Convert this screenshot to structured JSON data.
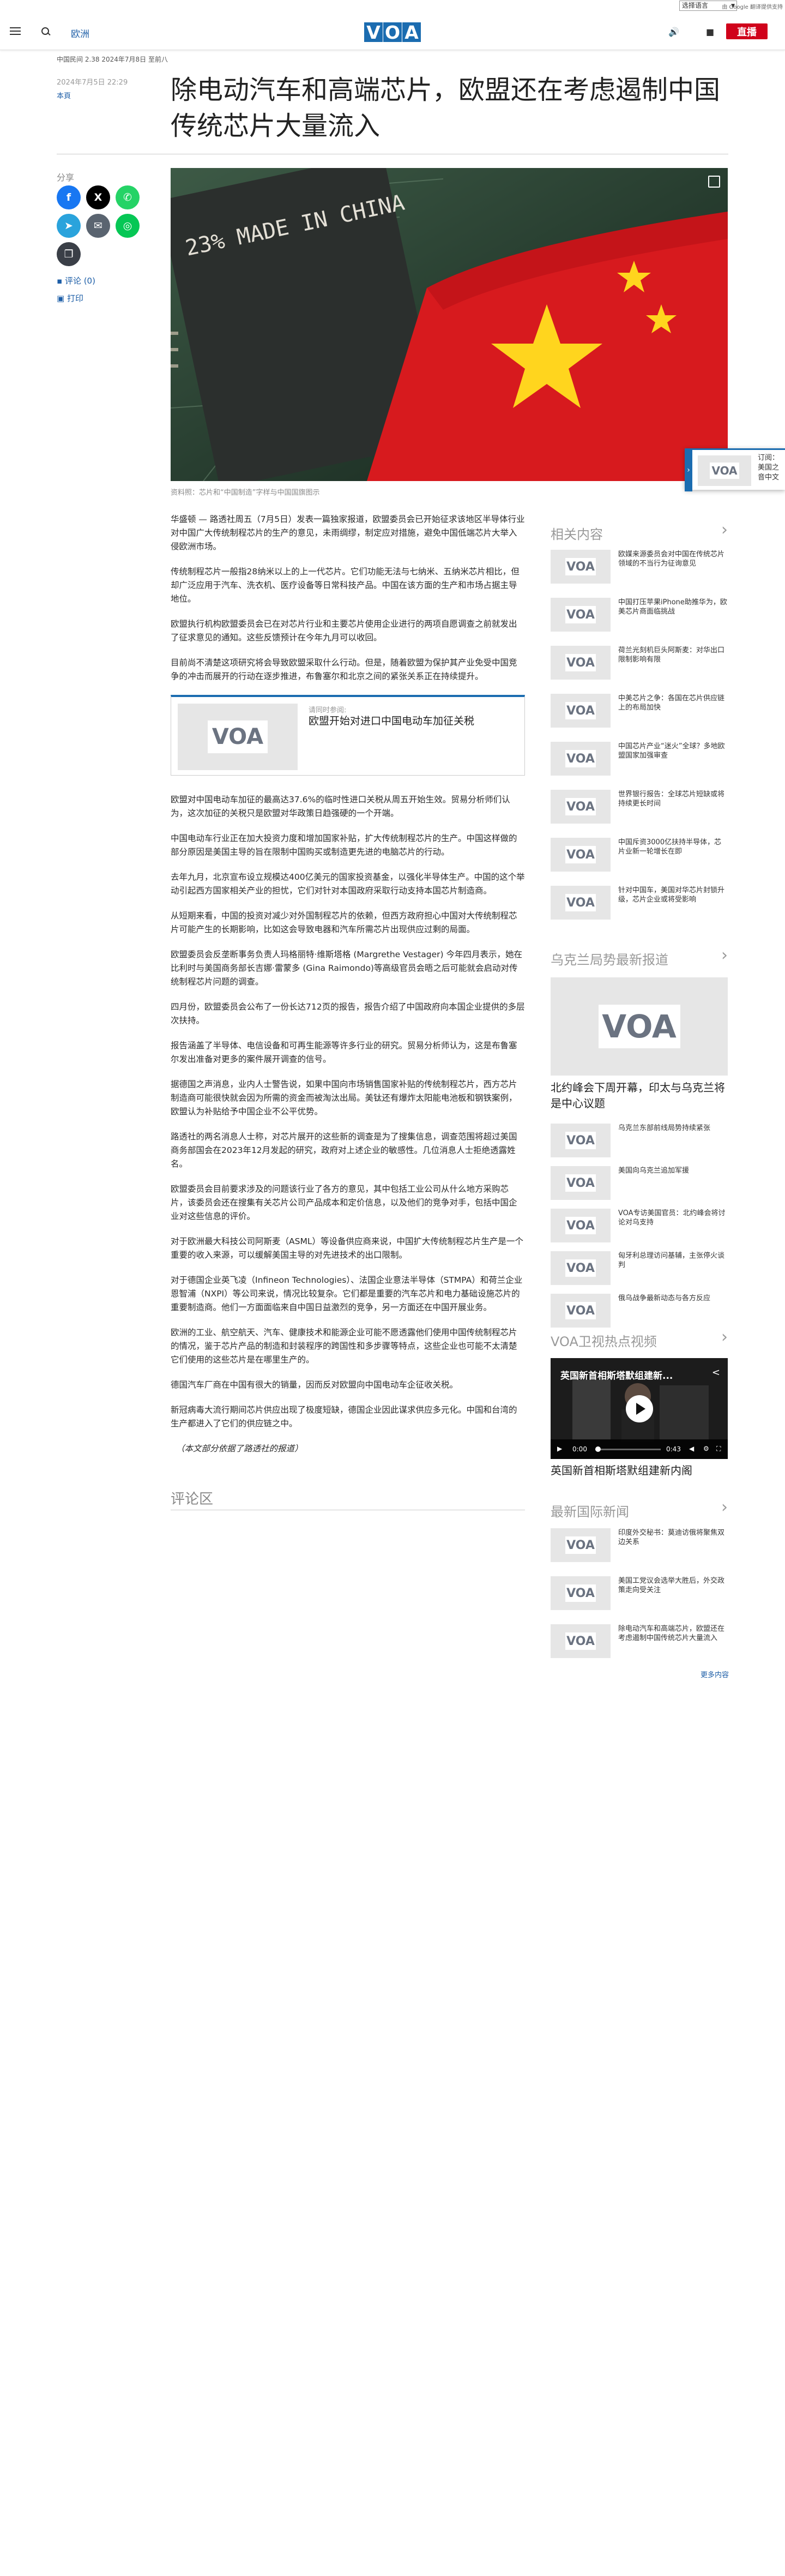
{
  "topbar": {
    "language_select": "选择语言",
    "translate_powered": "由 Google 翻译提供支持"
  },
  "header": {
    "section": "欧洲",
    "logo": [
      "V",
      "O",
      "A"
    ],
    "live_label": "直播"
  },
  "article": {
    "intro": "中国民间 2.38 2024年7月8日 至前八",
    "date": "2024年7月5日 22:29",
    "author": "本頁",
    "title": "除电动汽车和高端芯片，欧盟还在考虑遏制中国传统芯片大量流入",
    "share_label": "分享",
    "comment_link": "评论 (0)",
    "print_link": "打印",
    "image_caption": "资料照：芯片和“中国制造”字样与中国国旗图示",
    "image_text": "23% MADE IN CHINA",
    "paragraphs_a": [
      "华盛顿 — 路透社周五（7月5日）发表一篇独家报道，欧盟委员会已开始征求该地区半导体行业对中国广大传统制程芯片的生产的意见，未雨绸缪，制定应对措施，避免中国低端芯片大举入侵欧洲市场。",
      "传统制程芯片一般指28纳米以上的上一代芯片。它们功能无法与七纳米、五纳米芯片相比，但却广泛应用于汽车、洗衣机、医疗设备等日常科技产品。中国在该方面的生产和市场占据主导地位。",
      "欧盟执行机构欧盟委员会已在对芯片行业和主要芯片使用企业进行的两项自愿调查之前就发出了征求意见的通知。这些反馈预计在今年九月可以收回。",
      "目前尚不清楚这项研究将会导致欧盟采取什么行动。但是，随着欧盟为保护其产业免受中国竞争的冲击而展开的行动在逐步推进，布鲁塞尔和北京之间的紧张关系正在持续提升。"
    ],
    "related": {
      "label": "请同时参阅:",
      "title": "欧盟开始对进口中国电动车加征关税"
    },
    "paragraphs_b": [
      "欧盟对中国电动车加征的最高达37.6%的临时性进口关税从周五开始生效。贸易分析师们认为，这次加征的关税只是欧盟对华政策日趋强硬的一个开端。",
      "中国电动车行业正在加大投资力度和增加国家补贴，扩大传统制程芯片的生产。中国这样做的部分原因是美国主导的旨在限制中国购买或制造更先进的电脑芯片的行动。",
      "去年九月，北京宣布设立规模达400亿美元的国家投资基金，以强化半导体生产。中国的这个举动引起西方国家相关产业的担忧，它们对针对本国政府采取行动支持本国芯片制造商。",
      "从短期来看，中国的投资对减少对外国制程芯片的依赖，但西方政府担心中国对大传统制程芯片可能产生的长期影响，比如这会导致电器和汽车所需芯片出现供应过剩的局面。",
      "欧盟委员会反垄断事务负责人玛格丽特·维斯塔格 (Margrethe Vestager) 今年四月表示，她在比利时与美国商务部长吉娜·雷蒙多 (Gina Raimondo)等高级官员会晤之后可能就会启动对传统制程芯片问题的调查。",
      "四月份，欧盟委员会公布了一份长达712页的报告，报告介绍了中国政府向本国企业提供的多层次扶持。",
      "报告涵盖了半导体、电信设备和可再生能源等许多行业的研究。贸易分析师认为，这是布鲁塞尔发出准备对更多的案件展开调查的信号。",
      "据德国之声消息，业内人士警告说，如果中国向市场销售国家补贴的传统制程芯片，西方芯片制造商可能很快就会因为所需的资金而被淘汰出局。美钛还有爆炸太阳能电池板和钢铁案例，欧盟认为补贴给予中国企业不公平优势。",
      "路透社的两名消息人士称，对芯片展开的这些新的调查是为了搜集信息，调查范围将超过美国商务部国会在2023年12月发起的研究，政府对上述企业的敏感性。几位消息人士拒绝透露姓名。",
      "欧盟委员会目前要求涉及的问题该行业了各方的意见，其中包括工业公司从什么地方采购芯片，该委员会还在搜集有关芯片公司产品成本和定价信息，以及他们的竞争对手，包括中国企业对这些信息的评价。",
      "对于欧洲最大科技公司阿斯麦（ASML）等设备供应商来说，中国扩大传统制程芯片生产是一个重要的收入来源，可以缓解美国主导的对先进技术的出口限制。",
      "对于德国企业英飞凌（Infineon Technologies）、法国企业意法半导体（STMPA）和荷兰企业恩智浦（NXPI）等公司来说，情况比较复杂。它们都是重要的汽车芯片和电力基础设施芯片的重要制造商。他们一方面面临来自中国日益激烈的竞争，另一方面还在中国开展业务。",
      "欧洲的工业、航空航天、汽车、健康技术和能源企业可能不愿透露他们使用中国传统制程芯片的情况，鉴于芯片产品的制造和封装程序的跨国性和多步骤等特点，这些企业也可能不太清楚它们使用的这些芯片是在哪里生产的。",
      "德国汽车厂商在中国有很大的销量，因而反对欧盟向中国电动车企征收关税。",
      "新冠病毒大流行期间芯片供应出现了极度短缺，德国企业因此谋求供应多元化。中国和台湾的生产都进入了它们的供应链之中。"
    ],
    "closing_note": "（本文部分依据了路透社的报道）",
    "comments_title": "评论区"
  },
  "sidebar": {
    "related_title": "相关内容",
    "related_items": [
      "欧媒来源委员会对中国在传统芯片领域的不当行为征询意见",
      "中国打压苹果iPhone助推华为，欧美芯片商面临挑战",
      "荷兰光刻机巨头阿斯麦：对华出口限制影响有限",
      "中美芯片之争：各国在芯片供应链上的布局加快",
      "中国芯片产业“迷火”全球？多地欧盟国家加强审查",
      "世界银行报告：全球芯片短缺或将持续更长时间",
      "中国斥资3000亿扶持半导体，芯片业新一轮增长在即",
      "针对中国车，美国对华芯片封锁升级，芯片企业或将受影响"
    ],
    "ukraine_title": "乌克兰局势最新报道",
    "ukraine_lead": "北约峰会下周开幕，印太与乌克兰将是中心议题",
    "ukraine_items": [
      "乌克兰东部前线局势持续紧张",
      "美国向乌克兰追加军援",
      "VOA专访美国官员：北约峰会将讨论对乌支持",
      "匈牙利总理访问基辅，主张停火谈判",
      "俄乌战争最新动态与各方反应"
    ],
    "video_title": "VOA卫视热点视频",
    "video": {
      "overlay_title": "英国新首相斯塔默组建新...",
      "share_icon": "share-icon",
      "time_current": "0:00",
      "time_total": "0:43",
      "caption": "英国新首相斯塔默组建新内阁"
    },
    "intl_title": "最新国际新闻",
    "intl_items": [
      "印度外交秘书：莫迪访俄将聚焦双边关系",
      "美国工党议会选举大胜后，外交政策走向受关注",
      "除电动汽车和高端芯片，欧盟还在考虑遏制中国传统芯片大量流入"
    ],
    "more_label": "更多内容"
  },
  "popup": {
    "arrow": "›",
    "text": "订阅：美国之音中文"
  },
  "colors": {
    "brand": "#1b6cb0",
    "live": "#d0021b",
    "facebook": "#1877f2",
    "x": "#000000",
    "whatsapp": "#25d366",
    "telegram": "#2aa3dc",
    "email": "#5a6470",
    "line": "#06c755"
  }
}
